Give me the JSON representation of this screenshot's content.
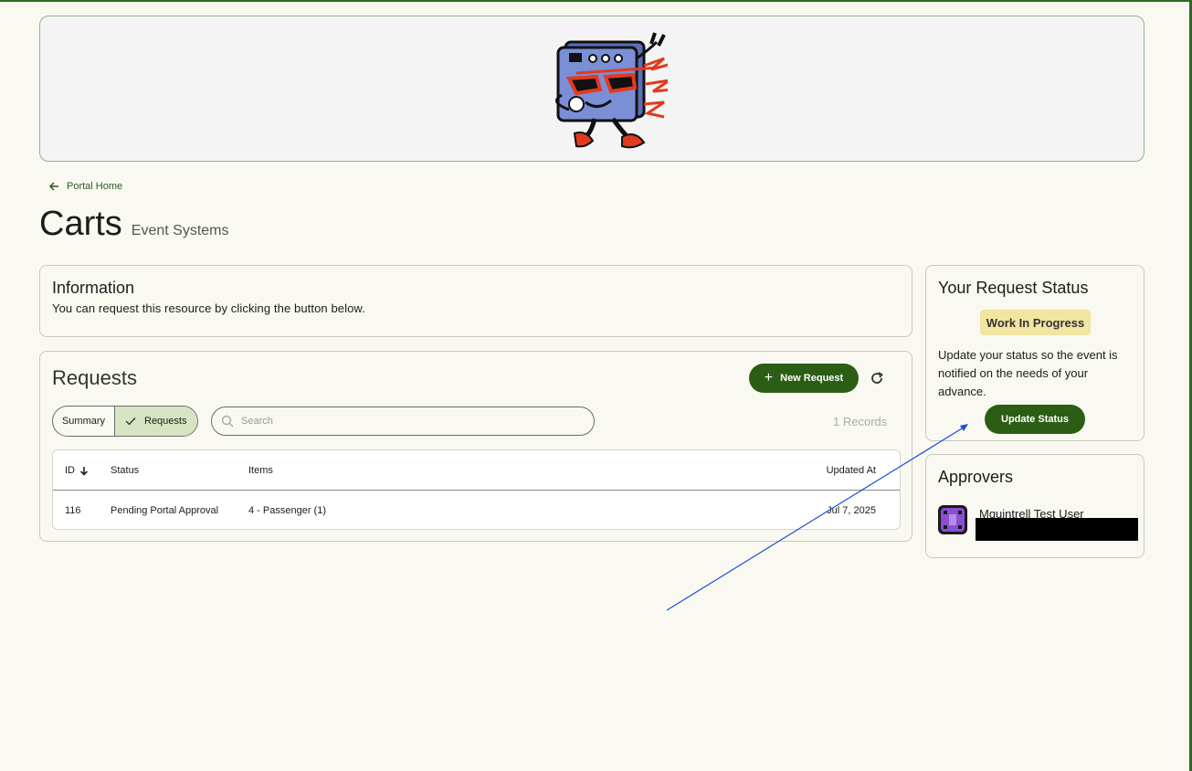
{
  "nav": {
    "back_label": "Portal Home"
  },
  "header": {
    "title": "Carts",
    "subtitle": "Event Systems"
  },
  "information": {
    "title": "Information",
    "text": "You can request this resource by clicking the button below."
  },
  "requests": {
    "title": "Requests",
    "new_button_label": "New Request",
    "tabs": [
      {
        "label": "Summary",
        "active": false
      },
      {
        "label": "Requests",
        "active": true
      }
    ],
    "search_placeholder": "Search",
    "records_count": "1 Records",
    "columns": [
      "ID",
      "Status",
      "Items",
      "Updated At"
    ],
    "rows": [
      {
        "id": "116",
        "status": "Pending Portal Approval",
        "items": "4 - Passenger (1)",
        "updated_at": "Jul 7, 2025"
      }
    ]
  },
  "request_status": {
    "title": "Your Request Status",
    "badge": "Work In Progress",
    "description": "Update your status so the event is notified on the needs of your advance.",
    "button_label": "Update Status"
  },
  "approvers": {
    "title": "Approvers",
    "items": [
      {
        "name": "Mquintrell Test User"
      }
    ]
  },
  "colors": {
    "primary": "#2b5e14",
    "badge_bg": "#f2e4a1",
    "active_tab": "#d7e4c3",
    "annotation_arrow": "#1a4fd6"
  }
}
